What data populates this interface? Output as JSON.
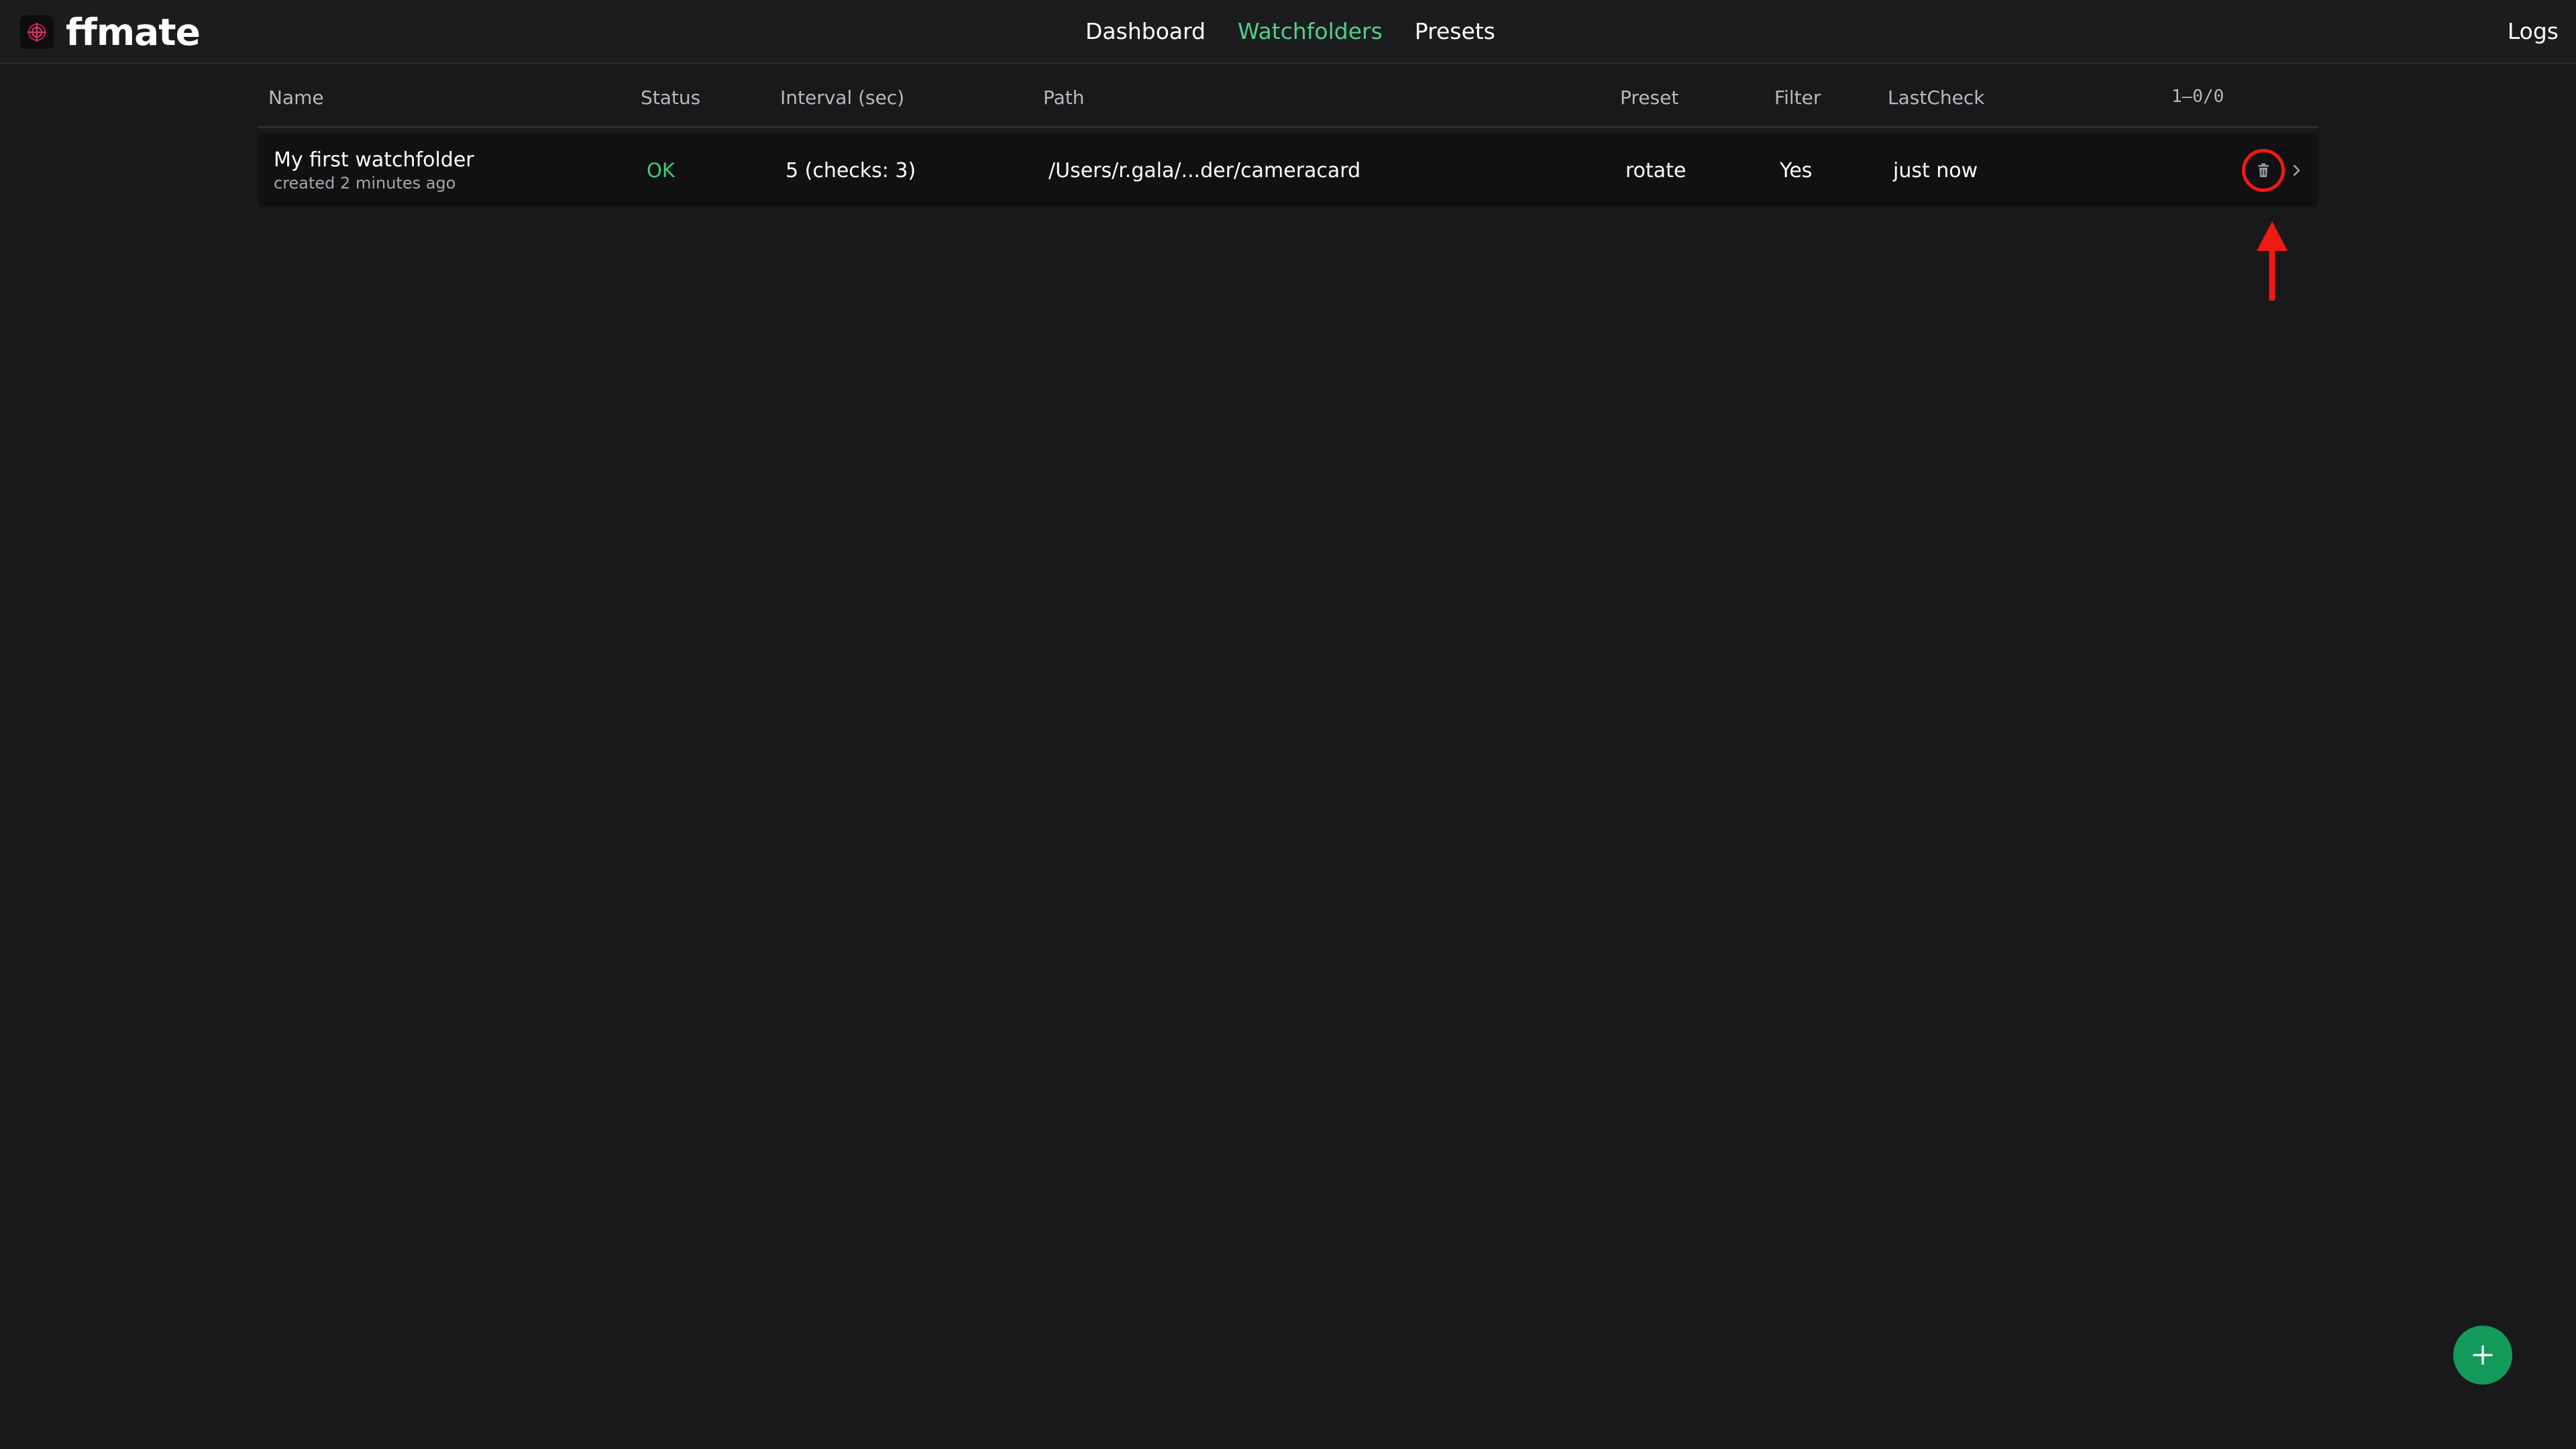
{
  "app": {
    "name": "ffmate",
    "accent_color": "#4fd08c",
    "annotation_color": "#f01a14"
  },
  "nav": {
    "items": [
      {
        "label": "Dashboard",
        "active": false
      },
      {
        "label": "Watchfolders",
        "active": true
      },
      {
        "label": "Presets",
        "active": false
      }
    ],
    "logs_label": "Logs"
  },
  "table": {
    "columns": {
      "name": "Name",
      "status": "Status",
      "interval": "Interval (sec)",
      "path": "Path",
      "preset": "Preset",
      "filter": "Filter",
      "lastcheck": "LastCheck",
      "pagination": "1–0/0"
    },
    "rows": [
      {
        "name": "My first watchfolder",
        "created": "created 2 minutes ago",
        "status": "OK",
        "interval": "5 (checks: 3)",
        "path": "/Users/r.gala/...der/cameracard",
        "preset": "rotate",
        "filter": "Yes",
        "lastcheck": "just now",
        "delete_icon": "trash-icon",
        "open_icon": "chevron-right-icon"
      }
    ]
  },
  "fab": {
    "icon": "plus-icon",
    "color": "#139a5a"
  }
}
